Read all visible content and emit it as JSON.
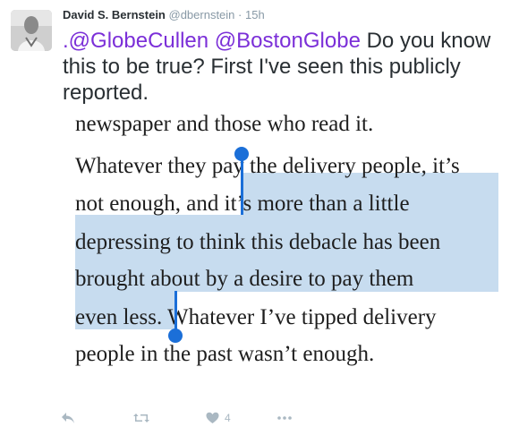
{
  "tweet": {
    "author_name": "David S. Bernstein",
    "author_handle": "@dbernstein",
    "separator": "·",
    "timestamp": "15h",
    "mention_1": ".@GlobeCullen",
    "mention_2": "@BostonGlobe",
    "text_line_1_rest": " Do you know",
    "text_line_2": "this to be true? First I've seen this publicly",
    "text_line_3": "reported."
  },
  "quote_image": {
    "line_1": "newspaper and those who read it.",
    "line_2": "Whatever they pay the delivery people, it’s",
    "line_3_before_selection": "not enough, and ",
    "line_3_selected": "it’s more than a little",
    "line_4": "depressing to think this debacle has been",
    "line_5": "brought about by a desire to pay them",
    "line_6_selected": "even less. ",
    "line_6_after_selection": "Whatever I’ve tipped delivery",
    "line_7": "people in the past wasn’t enough.",
    "selection_color": "#c7dcef",
    "handle_color": "#1b6fd8"
  },
  "actions": {
    "reply_icon": "reply-icon",
    "retweet_icon": "retweet-icon",
    "like_icon": "heart-icon",
    "like_count": "4",
    "more_icon": "more-dots-icon"
  }
}
